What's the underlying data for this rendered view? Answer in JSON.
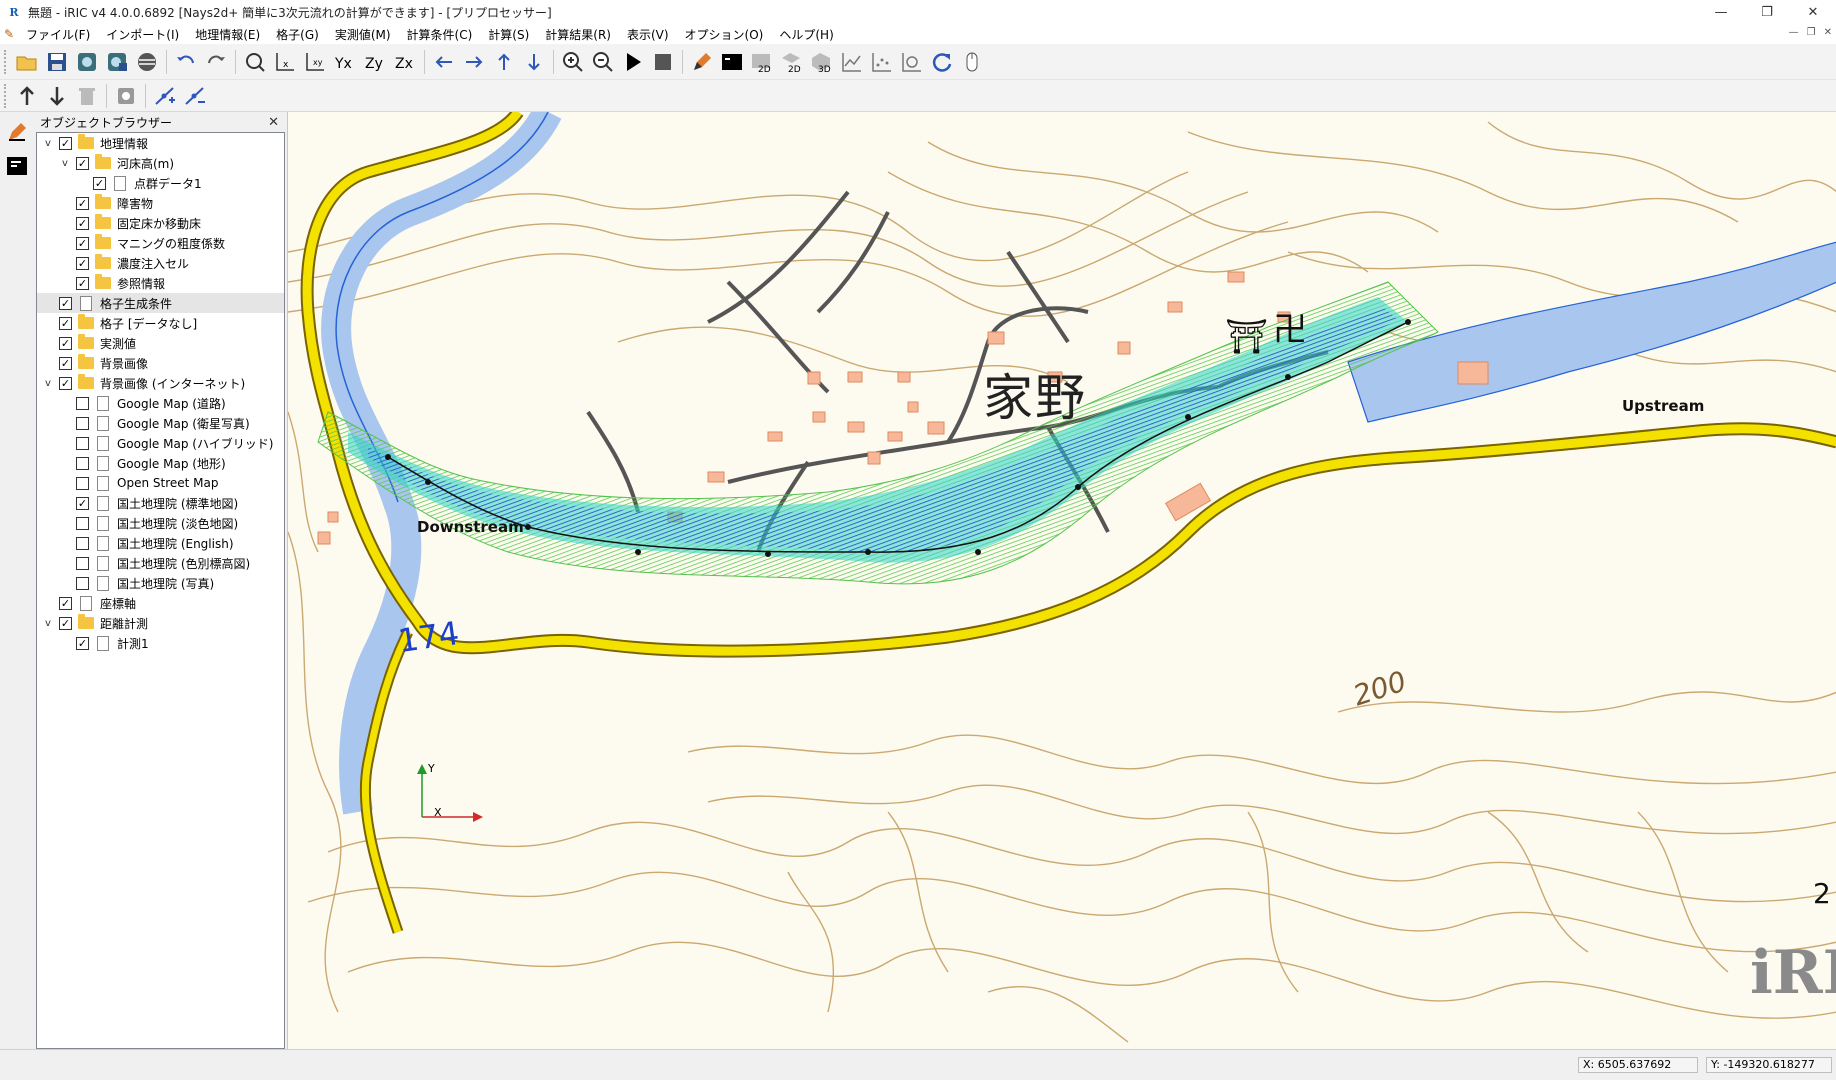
{
  "window": {
    "title": "無題 - iRIC v4 4.0.0.6892 [Nays2d+ 簡単に3次元流れの計算ができます] - [プリプロセッサー]",
    "app_icon_text": "R",
    "controls": [
      "—",
      "❐",
      "✕"
    ]
  },
  "menubar": {
    "items": [
      "ファイル(F)",
      "インポート(I)",
      "地理情報(E)",
      "格子(G)",
      "実測値(M)",
      "計算条件(C)",
      "計算(S)",
      "計算結果(R)",
      "表示(V)",
      "オプション(O)",
      "ヘルプ(H)"
    ],
    "mdi_controls": [
      "—",
      "❐",
      "✕"
    ]
  },
  "toolbar1": {
    "buttons": [
      {
        "name": "open-icon"
      },
      {
        "name": "save-icon"
      },
      {
        "name": "project-icon"
      },
      {
        "name": "project-save-icon"
      },
      {
        "name": "globe-icon"
      },
      {
        "name": "undo-icon"
      },
      {
        "name": "redo-icon"
      },
      {
        "name": "fit-view-icon"
      },
      {
        "name": "x-axis-icon"
      },
      {
        "name": "xy-axis-icon"
      },
      {
        "name": "yx-axis-icon"
      },
      {
        "name": "zy-axis-icon"
      },
      {
        "name": "zx-axis-icon"
      },
      {
        "name": "arrow-left-icon"
      },
      {
        "name": "arrow-right-icon"
      },
      {
        "name": "arrow-up-icon"
      },
      {
        "name": "arrow-down-icon"
      },
      {
        "name": "zoom-in-icon"
      },
      {
        "name": "zoom-out-icon"
      },
      {
        "name": "play-icon"
      },
      {
        "name": "stop-icon"
      },
      {
        "name": "pencil-icon"
      },
      {
        "name": "console-icon"
      },
      {
        "name": "2d-icon"
      },
      {
        "name": "2d-alt-icon"
      },
      {
        "name": "3d-icon"
      },
      {
        "name": "graph-icon"
      },
      {
        "name": "scatter-icon"
      },
      {
        "name": "search-graph-icon"
      },
      {
        "name": "refresh-icon"
      },
      {
        "name": "mouse-icon"
      }
    ]
  },
  "toolbar2": {
    "buttons": [
      {
        "name": "move-up-icon"
      },
      {
        "name": "move-down-icon"
      },
      {
        "name": "delete-icon"
      },
      {
        "name": "settings-icon"
      },
      {
        "name": "add-point-icon"
      },
      {
        "name": "remove-point-icon"
      }
    ]
  },
  "browser": {
    "title": "オブジェクトブラウザー",
    "close": "✕",
    "items": [
      {
        "label": "地理情報",
        "level": 0,
        "expander": "v",
        "checked": true,
        "icon": "folder"
      },
      {
        "label": "河床高(m)",
        "level": 1,
        "expander": "v",
        "checked": true,
        "icon": "folder"
      },
      {
        "label": "点群データ1",
        "level": 2,
        "expander": "",
        "checked": true,
        "icon": "doc"
      },
      {
        "label": "障害物",
        "level": 1,
        "expander": "",
        "checked": true,
        "icon": "folder"
      },
      {
        "label": "固定床か移動床",
        "level": 1,
        "expander": "",
        "checked": true,
        "icon": "folder"
      },
      {
        "label": "マニングの粗度係数",
        "level": 1,
        "expander": "",
        "checked": true,
        "icon": "folder"
      },
      {
        "label": "濃度注入セル",
        "level": 1,
        "expander": "",
        "checked": true,
        "icon": "folder"
      },
      {
        "label": "参照情報",
        "level": 1,
        "expander": "",
        "checked": true,
        "icon": "folder"
      },
      {
        "label": "格子生成条件",
        "level": 0,
        "expander": "",
        "checked": true,
        "icon": "doc",
        "selected": true
      },
      {
        "label": "格子 [データなし]",
        "level": 0,
        "expander": "",
        "checked": true,
        "icon": "folder"
      },
      {
        "label": "実測値",
        "level": 0,
        "expander": "",
        "checked": true,
        "icon": "folder"
      },
      {
        "label": "背景画像",
        "level": 0,
        "expander": "",
        "checked": true,
        "icon": "folder"
      },
      {
        "label": "背景画像 (インターネット)",
        "level": 0,
        "expander": "v",
        "checked": true,
        "icon": "folder"
      },
      {
        "label": "Google Map (道路)",
        "level": 1,
        "expander": "",
        "checked": false,
        "icon": "doc"
      },
      {
        "label": "Google Map (衛星写真)",
        "level": 1,
        "expander": "",
        "checked": false,
        "icon": "doc"
      },
      {
        "label": "Google Map (ハイブリッド)",
        "level": 1,
        "expander": "",
        "checked": false,
        "icon": "doc"
      },
      {
        "label": "Google Map (地形)",
        "level": 1,
        "expander": "",
        "checked": false,
        "icon": "doc"
      },
      {
        "label": "Open Street Map",
        "level": 1,
        "expander": "",
        "checked": false,
        "icon": "doc"
      },
      {
        "label": "国土地理院 (標準地図)",
        "level": 1,
        "expander": "",
        "checked": true,
        "icon": "doc"
      },
      {
        "label": "国土地理院 (淡色地図)",
        "level": 1,
        "expander": "",
        "checked": false,
        "icon": "doc"
      },
      {
        "label": "国土地理院 (English)",
        "level": 1,
        "expander": "",
        "checked": false,
        "icon": "doc"
      },
      {
        "label": "国土地理院 (色別標高図)",
        "level": 1,
        "expander": "",
        "checked": false,
        "icon": "doc"
      },
      {
        "label": "国土地理院 (写真)",
        "level": 1,
        "expander": "",
        "checked": false,
        "icon": "doc"
      },
      {
        "label": "座標軸",
        "level": 0,
        "expander": "",
        "checked": true,
        "icon": "doc"
      },
      {
        "label": "距離計測",
        "level": 0,
        "expander": "v",
        "checked": true,
        "icon": "folder"
      },
      {
        "label": "計測1",
        "level": 1,
        "expander": "",
        "checked": true,
        "icon": "doc"
      }
    ]
  },
  "map": {
    "downstream_label": "Downstream",
    "upstream_label": "Upstream",
    "place_name": "家野",
    "elevation_174": "174",
    "elevation_200": "200",
    "elevation_2": "2",
    "shrine_symbol": "⛩",
    "temple_symbol": "卍",
    "axis_x": "X",
    "axis_y": "Y",
    "watermark": "iRIC",
    "colors": {
      "contour": "#c8a46a",
      "road_yellow": "#f3e100",
      "river": "#8fb3e8",
      "grid_green": "#7bd36b",
      "grid_cyan": "#2fd3c9",
      "grid_blue": "#3a54e6",
      "building": "#f2a07a"
    }
  },
  "status": {
    "x": "X: 6505.637692",
    "y": "Y: -149320.618277"
  }
}
